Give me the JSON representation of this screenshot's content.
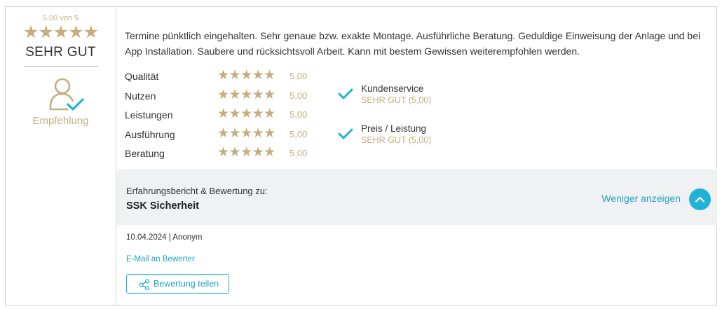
{
  "colors": {
    "gold": "#c4ae7f",
    "accent": "#1fb3d6",
    "link": "#1fa3c4",
    "band_bg": "#f0f1f3"
  },
  "summary": {
    "score_text": "5,00 von 5",
    "stars": "★★★★★",
    "grade": "SEHR GUT",
    "recommendation_icon": "user-check-icon",
    "recommendation_label": "Empfehlung"
  },
  "review": {
    "text": "Termine pünktlich eingehalten. Sehr genaue bzw. exakte Montage. Ausführliche Beratung. Geduldige Einweisung der Anlage und bei App Installation. Saubere und rücksichtsvoll Arbeit. Kann mit bestem Gewissen weiterempfohlen werden."
  },
  "criteria": [
    {
      "label": "Qualität",
      "stars": "★★★★★",
      "score": "5,00"
    },
    {
      "label": "Nutzen",
      "stars": "★★★★★",
      "score": "5,00"
    },
    {
      "label": "Leistungen",
      "stars": "★★★★★",
      "score": "5,00"
    },
    {
      "label": "Ausführung",
      "stars": "★★★★★",
      "score": "5,00"
    },
    {
      "label": "Beratung",
      "stars": "★★★★★",
      "score": "5,00"
    }
  ],
  "recommendations": [
    {
      "name": "Kundenservice",
      "grade": "SEHR GUT (5,00)",
      "icon": "check-icon"
    },
    {
      "name": "Preis / Leistung",
      "grade": "SEHR GUT (5,00)",
      "icon": "check-icon"
    }
  ],
  "band": {
    "label": "Erfahrungsbericht & Bewertung zu:",
    "company": "SSK Sicherheit",
    "toggle_label": "Weniger anzeigen",
    "toggle_icon": "chevron-up-icon"
  },
  "footer": {
    "meta": "10.04.2024 | Anonym",
    "email_link": "E-Mail an Bewerter",
    "share_label": "Bewertung teilen",
    "share_icon": "share-icon"
  }
}
